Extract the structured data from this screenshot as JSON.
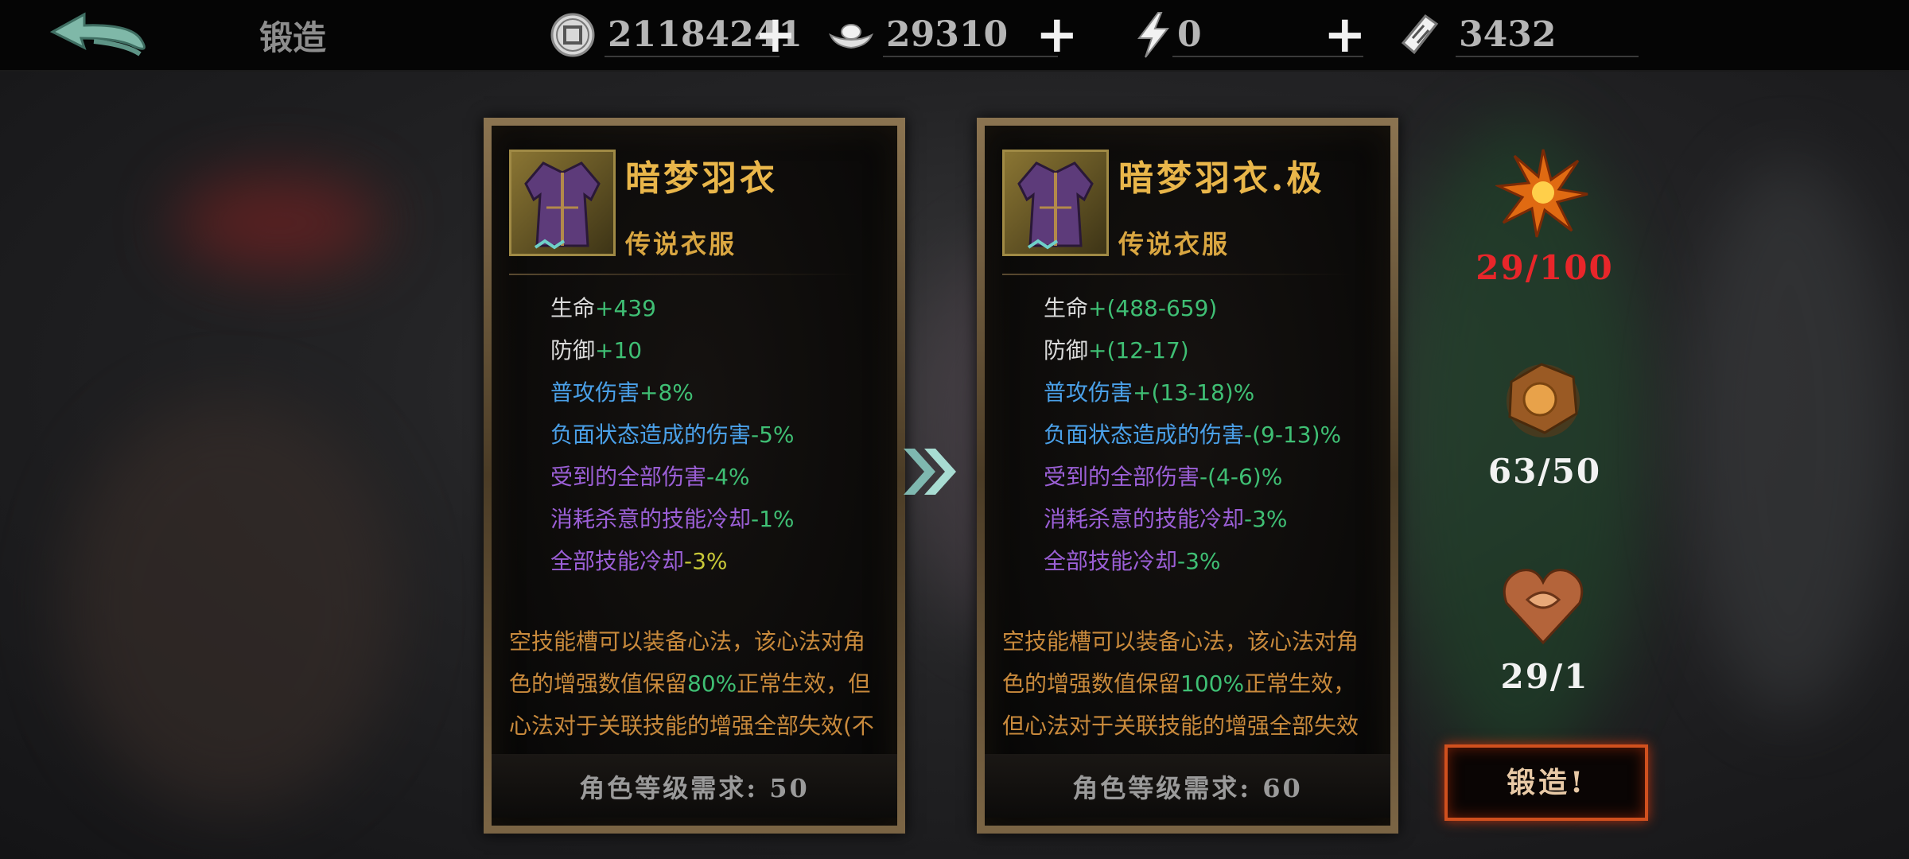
{
  "header": {
    "title": "锻造",
    "resources": [
      {
        "icon": "coin-icon",
        "value": "21184241"
      },
      {
        "icon": "silver-ingot-icon",
        "value": "29310"
      },
      {
        "icon": "lightning-icon",
        "value": "0"
      },
      {
        "icon": "ticket-icon",
        "value": "3432"
      }
    ],
    "plus_label": "+"
  },
  "current_item": {
    "name": "暗梦羽衣",
    "type": "传说衣服",
    "stats": [
      {
        "label": "生命",
        "value": "+439",
        "label_color": "#dcdcdc",
        "value_color": "#3fbf74"
      },
      {
        "label": "防御",
        "value": "+10",
        "label_color": "#dcdcdc",
        "value_color": "#3fbf74"
      },
      {
        "label": "普攻伤害",
        "value": "+8%",
        "label_color": "#4aa0e8",
        "value_color": "#3fbf74"
      },
      {
        "label": "负面状态造成的伤害",
        "value": "-5%",
        "label_color": "#4aa0e8",
        "value_color": "#3fbf74"
      },
      {
        "label": "受到的全部伤害",
        "value": "-4%",
        "label_color": "#9b5fd6",
        "value_color": "#3fbf74"
      },
      {
        "label": "消耗杀意的技能冷却",
        "value": "-1%",
        "label_color": "#9b5fd6",
        "value_color": "#3fbf74"
      },
      {
        "label": "全部技能冷却",
        "value": "-3%",
        "label_color": "#9b5fd6",
        "value_color": "#c8c838"
      }
    ],
    "desc_part1": "空技能槽可以装备心法，该心法对角色的增强数值保留",
    "desc_highlight": "80%",
    "desc_part2": "正常生效，但心法对于关联技能的增强全部失效(不具体技能会回放)暗技萧萧",
    "requirement": "角色等级需求: 50"
  },
  "upgraded_item": {
    "name": "暗梦羽衣.极",
    "type": "传说衣服",
    "stats": [
      {
        "label": "生命",
        "value": "+(488-659)",
        "label_color": "#dcdcdc",
        "value_color": "#3fbf74"
      },
      {
        "label": "防御",
        "value": "+(12-17)",
        "label_color": "#dcdcdc",
        "value_color": "#3fbf74"
      },
      {
        "label": "普攻伤害",
        "value": "+(13-18)%",
        "label_color": "#4aa0e8",
        "value_color": "#3fbf74"
      },
      {
        "label": "负面状态造成的伤害",
        "value": "-(9-13)%",
        "label_color": "#4aa0e8",
        "value_color": "#3fbf74"
      },
      {
        "label": "受到的全部伤害",
        "value": "-(4-6)%",
        "label_color": "#9b5fd6",
        "value_color": "#3fbf74"
      },
      {
        "label": "消耗杀意的技能冷却",
        "value": "-3%",
        "label_color": "#9b5fd6",
        "value_color": "#3fbf74"
      },
      {
        "label": "全部技能冷却",
        "value": "-3%",
        "label_color": "#9b5fd6",
        "value_color": "#3fbf74"
      }
    ],
    "desc_part1": "空技能槽可以装备心法，该心法对角色的增强数值保留",
    "desc_highlight": "100%",
    "desc_part2": "正常生效，但心法对于关联技能的增强全部失效(不具体技能会回放)暗技萧萧",
    "requirement": "角色等级需求: 60"
  },
  "materials": [
    {
      "icon": "fire-leaf-icon",
      "count": "29/100",
      "color": "#e8262a"
    },
    {
      "icon": "ore-chunk-icon",
      "count": "63/50",
      "color": "#f2f2f2"
    },
    {
      "icon": "heart-crest-icon",
      "count": "29/1",
      "color": "#f2f2f2"
    }
  ],
  "forge_button": "锻造!",
  "arrow_icon": "double-chevron-right-icon"
}
